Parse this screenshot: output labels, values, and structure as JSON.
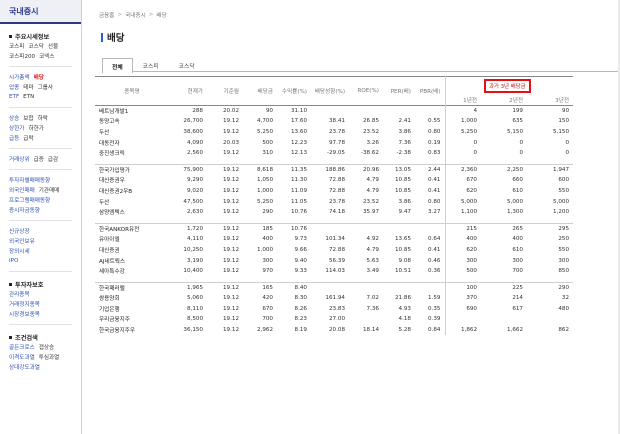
{
  "sidebar": {
    "title": "국내증시",
    "sections": [
      {
        "heading": "주요시세정보",
        "rows": [
          [
            "코스피",
            "코스닥",
            "선물"
          ],
          [
            "코스피200",
            "코넥스"
          ]
        ]
      },
      {
        "heading": "",
        "rows": [
          [
            "시가총액",
            "배당"
          ],
          [
            "업종",
            "테마",
            "그룹사"
          ],
          [
            "ETF",
            "ETN"
          ]
        ]
      },
      {
        "heading": "",
        "rows": [
          [
            "상승",
            "보합",
            "하락"
          ],
          [
            "상한가",
            "하한가"
          ],
          [
            "급등",
            "급락"
          ]
        ]
      },
      {
        "heading": "",
        "rows": [
          [
            "거래상위",
            "급증",
            "급감"
          ]
        ]
      },
      {
        "heading": "",
        "rows": [
          [
            "투자자별매매동향"
          ],
          [
            "외국인매매",
            "기관매매"
          ],
          [
            "프로그램매매동향"
          ],
          [
            "증시자금동향"
          ]
        ]
      },
      {
        "heading": "",
        "rows": [
          [
            "신규상장"
          ],
          [
            "외국인보유"
          ],
          [
            "장외시세"
          ],
          [
            "IPO"
          ]
        ]
      },
      {
        "heading": "투자자보호",
        "rows": [
          [
            "관리종목"
          ],
          [
            "거래정지종목"
          ],
          [
            "시장경보종목"
          ]
        ]
      },
      {
        "heading": "조건검색",
        "rows": [
          [
            "골든크로스",
            "갭상승"
          ],
          [
            "이격도과열",
            "투심과열"
          ],
          [
            "상대강도과열"
          ]
        ]
      }
    ],
    "active_item": "배당"
  },
  "breadcrumb": [
    "금융홈",
    "국내증시",
    "배당"
  ],
  "page_title": "배당",
  "tabs": [
    {
      "label": "전체",
      "active": true
    },
    {
      "label": "코스피",
      "active": false
    },
    {
      "label": "코스닥",
      "active": false
    }
  ],
  "table": {
    "headers": [
      "종목명",
      "현재가",
      "기준월",
      "배당금",
      "수익률(%)",
      "배당성향(%)",
      "ROE(%)",
      "PER(배)",
      "PBR(배)"
    ],
    "badge": "과거 3년 배당금",
    "sub_headers": [
      "1년전",
      "2년전",
      "3년전"
    ],
    "groups": [
      [
        [
          "베트남개발1",
          "288",
          "20.02",
          "90",
          "31.10",
          "",
          "",
          "",
          "",
          "4",
          "199",
          "90"
        ],
        [
          "동양고속",
          "26,700",
          "19.12",
          "4,700",
          "17.60",
          "38.41",
          "26.85",
          "2.41",
          "0.55",
          "1,000",
          "635",
          "150"
        ],
        [
          "두산",
          "38,600",
          "19.12",
          "5,250",
          "13.60",
          "23.78",
          "23.52",
          "3.86",
          "0.80",
          "5,250",
          "5,150",
          "5,150"
        ],
        [
          "대동전자",
          "4,090",
          "20.03",
          "500",
          "12.23",
          "97.78",
          "3.26",
          "7.36",
          "0.19",
          "0",
          "0",
          "0"
        ],
        [
          "중진생크릭",
          "2,560",
          "19.12",
          "310",
          "12.13",
          "-29.05",
          "-38.62",
          "-2.38",
          "0.83",
          "0",
          "0",
          "0"
        ]
      ],
      [
        [
          "한국가입평가",
          "75,900",
          "19.12",
          "8,618",
          "11.35",
          "188.86",
          "20.96",
          "13.05",
          "2.44",
          "2,360",
          "2,250",
          "1,947"
        ],
        [
          "대신증권우",
          "9,290",
          "19.12",
          "1,050",
          "11.30",
          "72.88",
          "4.79",
          "10.85",
          "0.41",
          "670",
          "660",
          "600"
        ],
        [
          "대신증권2우B",
          "9,020",
          "19.12",
          "1,000",
          "11.09",
          "72.88",
          "4.79",
          "10.85",
          "0.41",
          "620",
          "610",
          "550"
        ],
        [
          "두산",
          "47,500",
          "19.12",
          "5,250",
          "11.05",
          "23.78",
          "23.52",
          "3.86",
          "0.80",
          "5,000",
          "5,000",
          "5,000"
        ],
        [
          "삼양엠텍스",
          "2,630",
          "19.12",
          "290",
          "10.76",
          "74.18",
          "35.97",
          "9.47",
          "3.27",
          "1,100",
          "1,300",
          "1,200"
        ]
      ],
      [
        [
          "한국ANKOR유전",
          "1,720",
          "19.12",
          "185",
          "10.76",
          "",
          "",
          "",
          "",
          "215",
          "265",
          "295"
        ],
        [
          "유아이엘",
          "4,110",
          "19.12",
          "400",
          "9.73",
          "101.34",
          "4.92",
          "13.65",
          "0.64",
          "400",
          "400",
          "250"
        ],
        [
          "대신증권",
          "10,250",
          "19.12",
          "1,000",
          "9.66",
          "72.88",
          "4.79",
          "10.85",
          "0.41",
          "620",
          "610",
          "550"
        ],
        [
          "AJ네트웍스",
          "3,190",
          "19.12",
          "300",
          "9.40",
          "56.39",
          "5.63",
          "9.08",
          "0.46",
          "300",
          "300",
          "300"
        ],
        [
          "세아특수강",
          "10,400",
          "19.12",
          "970",
          "9.33",
          "114.03",
          "3.49",
          "10.51",
          "0.36",
          "500",
          "700",
          "850"
        ]
      ],
      [
        [
          "한국패러랠",
          "1,965",
          "19.12",
          "165",
          "8.40",
          "",
          "",
          "",
          "",
          "100",
          "225",
          "290"
        ],
        [
          "쌍용양회",
          "5,060",
          "19.12",
          "420",
          "8.30",
          "161.94",
          "7.02",
          "21.86",
          "1.59",
          "370",
          "214",
          "32"
        ],
        [
          "기업은행",
          "8,110",
          "19.12",
          "670",
          "8.26",
          "23.83",
          "7.36",
          "4.93",
          "0.35",
          "690",
          "617",
          "480"
        ],
        [
          "우리금융지주",
          "8,500",
          "19.12",
          "700",
          "8.23",
          "27.00",
          "",
          "4.18",
          "0.39",
          "",
          "",
          ""
        ],
        [
          "한국금융지주우",
          "36,150",
          "19.12",
          "2,962",
          "8.19",
          "20.08",
          "18.14",
          "5.28",
          "0.84",
          "1,862",
          "1,662",
          "862"
        ]
      ]
    ]
  }
}
